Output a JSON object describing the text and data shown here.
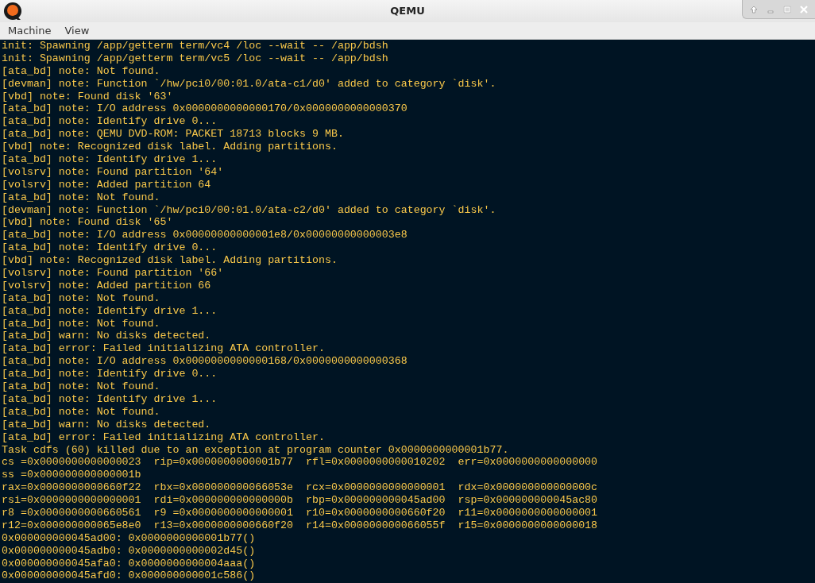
{
  "window": {
    "title": "QEMU"
  },
  "menu": [
    "Machine",
    "View"
  ],
  "console_lines": [
    "init: Spawning /app/getterm term/vc4 /loc --wait -- /app/bdsh",
    "init: Spawning /app/getterm term/vc5 /loc --wait -- /app/bdsh",
    "[ata_bd] note: Not found.",
    "[devman] note: Function `/hw/pci0/00:01.0/ata-c1/d0' added to category `disk'.",
    "[vbd] note: Found disk '63'",
    "[ata_bd] note: I/O address 0x0000000000000170/0x0000000000000370",
    "[ata_bd] note: Identify drive 0...",
    "[ata_bd] note: QEMU DVD-ROM: PACKET 18713 blocks 9 MB.",
    "[vbd] note: Recognized disk label. Adding partitions.",
    "[ata_bd] note: Identify drive 1...",
    "[volsrv] note: Found partition '64'",
    "[volsrv] note: Added partition 64",
    "[ata_bd] note: Not found.",
    "[devman] note: Function `/hw/pci0/00:01.0/ata-c2/d0' added to category `disk'.",
    "[vbd] note: Found disk '65'",
    "[ata_bd] note: I/O address 0x00000000000001e8/0x00000000000003e8",
    "[ata_bd] note: Identify drive 0...",
    "[vbd] note: Recognized disk label. Adding partitions.",
    "[volsrv] note: Found partition '66'",
    "[volsrv] note: Added partition 66",
    "[ata_bd] note: Not found.",
    "[ata_bd] note: Identify drive 1...",
    "[ata_bd] note: Not found.",
    "[ata_bd] warn: No disks detected.",
    "[ata_bd] error: Failed initializing ATA controller.",
    "[ata_bd] note: I/O address 0x0000000000000168/0x0000000000000368",
    "[ata_bd] note: Identify drive 0...",
    "[ata_bd] note: Not found.",
    "[ata_bd] note: Identify drive 1...",
    "[ata_bd] note: Not found.",
    "[ata_bd] warn: No disks detected.",
    "[ata_bd] error: Failed initializing ATA controller.",
    "Task cdfs (60) killed due to an exception at program counter 0x0000000000001b77.",
    "cs =0x0000000000000023  rip=0x0000000000001b77  rfl=0x0000000000010202  err=0x0000000000000000",
    "ss =0x000000000000001b",
    "rax=0x0000000000660f22  rbx=0x000000000066053e  rcx=0x0000000000000001  rdx=0x000000000000000c",
    "rsi=0x0000000000000001  rdi=0x000000000000000b  rbp=0x000000000045ad00  rsp=0x000000000045ac80",
    "r8 =0x0000000000660561  r9 =0x0000000000000001  r10=0x0000000000660f20  r11=0x0000000000000001",
    "r12=0x000000000065e8e0  r13=0x0000000000660f20  r14=0x000000000066055f  r15=0x0000000000000018",
    "0x000000000045ad00: 0x0000000000001b77()",
    "0x000000000045adb0: 0x0000000000002d45()",
    "0x000000000045afa0: 0x0000000000004aaa()",
    "0x000000000045afd0: 0x000000000001c586()"
  ]
}
